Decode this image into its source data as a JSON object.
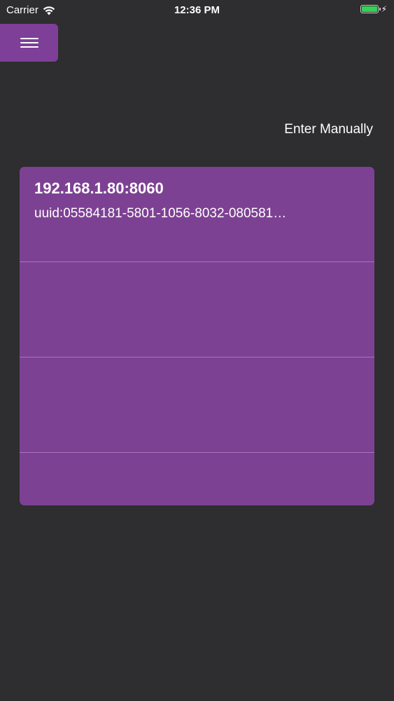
{
  "status_bar": {
    "carrier": "Carrier",
    "time": "12:36 PM",
    "battery_level": 1.0,
    "battery_color": "#37d158"
  },
  "header": {
    "menu_icon": "hamburger-icon",
    "enter_manually_label": "Enter Manually"
  },
  "colors": {
    "accent": "#7d3f98",
    "background": "#2e2d2f"
  },
  "devices": [
    {
      "address": "192.168.1.80:8060",
      "uuid": "uuid:05584181-5801-1056-8032-080581…"
    }
  ]
}
